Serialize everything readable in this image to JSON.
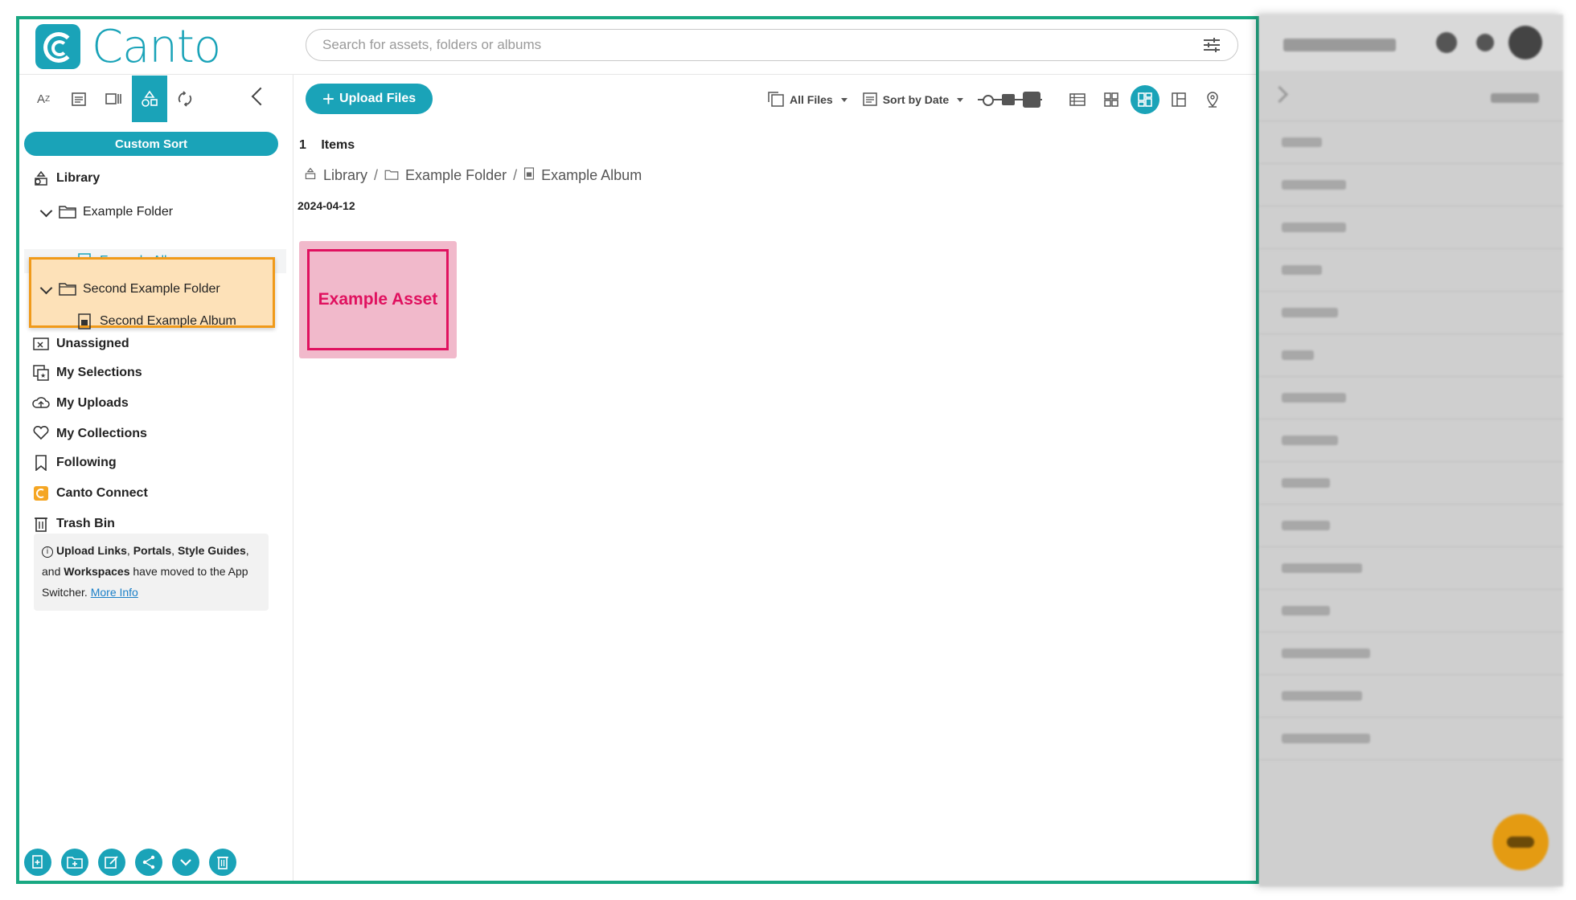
{
  "brand": {
    "name": "Canto"
  },
  "search": {
    "placeholder": "Search for assets, folders or albums"
  },
  "left_toolbar": {
    "tools": [
      "A↓Z",
      "calendar",
      "columns",
      "shapes",
      "sync"
    ]
  },
  "sidebar": {
    "custom_sort": "Custom Sort",
    "library": "Library",
    "example_folder": "Example Folder",
    "example_album": "Example Album",
    "second_folder": "Second Example Folder",
    "second_album": "Second Example Album",
    "unassigned": "Unassigned",
    "my_selections": "My Selections",
    "my_uploads": "My Uploads",
    "my_collections": "My Collections",
    "following": "Following",
    "canto_connect": "Canto Connect",
    "trash_bin": "Trash Bin"
  },
  "info": {
    "b1": "Upload Links",
    "sep1": ", ",
    "b2": "Portals",
    "sep2": ", ",
    "b3": "Style Guides",
    "mid": ", and ",
    "b4": "Workspaces",
    "rest": " have moved to the App Switcher. ",
    "link": "More Info"
  },
  "toolbar": {
    "upload": "Upload Files",
    "all_files": "All Files",
    "sort": "Sort by Date"
  },
  "content": {
    "count": "1",
    "items_label": "Items",
    "breadcrumb": [
      "Library",
      "Example Folder",
      "Example Album"
    ],
    "date": "2024-04-12",
    "asset": "Example Asset"
  },
  "colors": {
    "accent": "#1aa3b8",
    "frame": "#19a882",
    "highlight_bg": "#fde1b8",
    "highlight_border": "#f09a1a",
    "asset_bg": "#f1b9cb",
    "asset_text": "#e0115f"
  }
}
